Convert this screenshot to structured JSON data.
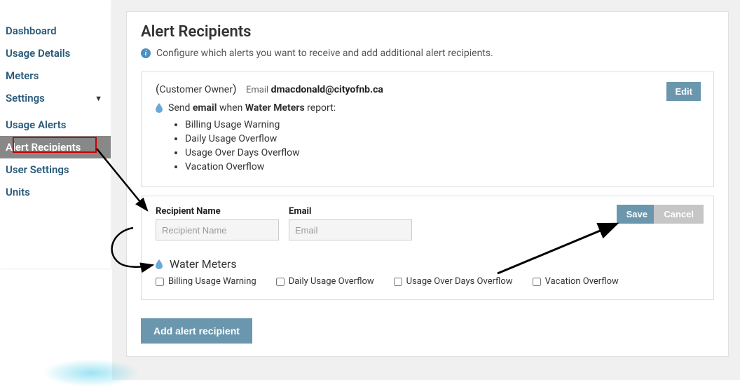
{
  "sidebar": {
    "items": [
      {
        "label": "Dashboard"
      },
      {
        "label": "Usage Details"
      },
      {
        "label": "Meters"
      },
      {
        "label": "Settings",
        "expanded": true
      }
    ],
    "sub": [
      {
        "label": "Usage Alerts"
      },
      {
        "label": "Alert Recipients"
      },
      {
        "label": "User Settings"
      },
      {
        "label": "Units"
      }
    ]
  },
  "page": {
    "title": "Alert Recipients",
    "info": "Configure which alerts you want to receive and add additional alert recipients."
  },
  "owner": {
    "role": "Customer Owner",
    "email_label": "Email",
    "email": "dmacdonald@cityofnb.ca",
    "edit_label": "Edit",
    "send_prefix": "Send",
    "send_kind": "email",
    "send_middle": "when",
    "send_section": "Water Meters",
    "send_suffix": "report:",
    "alerts": [
      "Billing Usage Warning",
      "Daily Usage Overflow",
      "Usage Over Days Overflow",
      "Vacation Overflow"
    ]
  },
  "form": {
    "name_label": "Recipient Name",
    "name_placeholder": "Recipient Name",
    "email_label": "Email",
    "email_placeholder": "Email",
    "save_label": "Save",
    "cancel_label": "Cancel",
    "meter_heading": "Water Meters",
    "options": [
      "Billing Usage Warning",
      "Daily Usage Overflow",
      "Usage Over Days Overflow",
      "Vacation Overflow"
    ]
  },
  "add_label": "Add alert recipient"
}
